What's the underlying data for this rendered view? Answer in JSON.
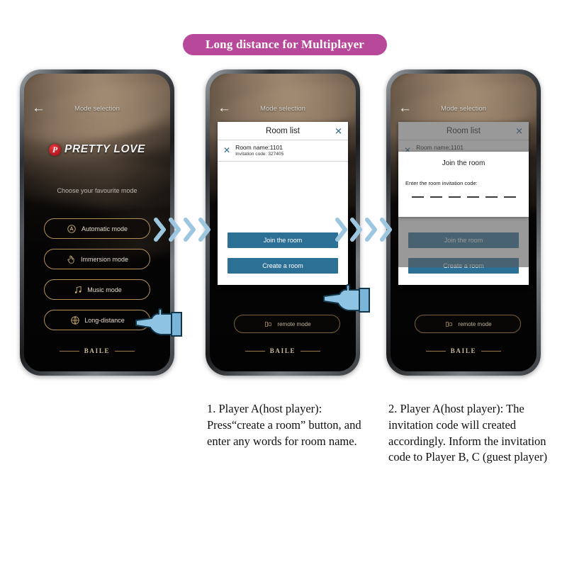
{
  "banner": {
    "title": "Long distance for Multiplayer",
    "color": "#b8489a"
  },
  "phone_screen": {
    "nav": {
      "back_icon": "arrow-left-icon",
      "title": "Mode selection"
    },
    "brand": {
      "badge_letter": "P",
      "name": "PRETTY LOVE",
      "badge_color": "#d12a32"
    },
    "prompt": "Choose your favourite mode",
    "modes": [
      {
        "label": "Automatic mode",
        "icon": "automatic-a-circle-icon"
      },
      {
        "label": "Immersion mode",
        "icon": "hand-pointer-icon"
      },
      {
        "label": "Music mode",
        "icon": "music-note-icon"
      },
      {
        "label": "Long-distance",
        "icon": "globe-icon"
      }
    ],
    "remote_mode": {
      "label": "remote mode",
      "icon": "remote-device-icon"
    },
    "footer_brand": "BAILE"
  },
  "room_dialog": {
    "title": "Room list",
    "close_icon": "close-x-icon",
    "rows": [
      {
        "remove_icon": "remove-x-icon",
        "name": "Room name:1101",
        "code": "Invitation code:  327405"
      }
    ],
    "buttons": [
      {
        "label": "Join the room",
        "color": "#2d7096"
      },
      {
        "label": "Create a room",
        "color": "#2d7096"
      }
    ]
  },
  "join_panel": {
    "title": "Join the room",
    "label": "Enter the room invitation code:",
    "digit_count": 6
  },
  "arrows": {
    "icon": "chevron-right-icon",
    "color": "#9dc6e0",
    "group_count": 3
  },
  "cursors": [
    {
      "name": "hand-pointer-cursor",
      "target": "long-distance-mode-button"
    },
    {
      "name": "hand-pointer-cursor",
      "target": "create-a-room-button"
    }
  ],
  "captions": [
    "1. Player A(host player): Press“create a room” button, and enter any words for room name.",
    "2. Player A(host player): The invitation code will created accordingly. Inform the invitation code to Player B, C (guest player)"
  ]
}
